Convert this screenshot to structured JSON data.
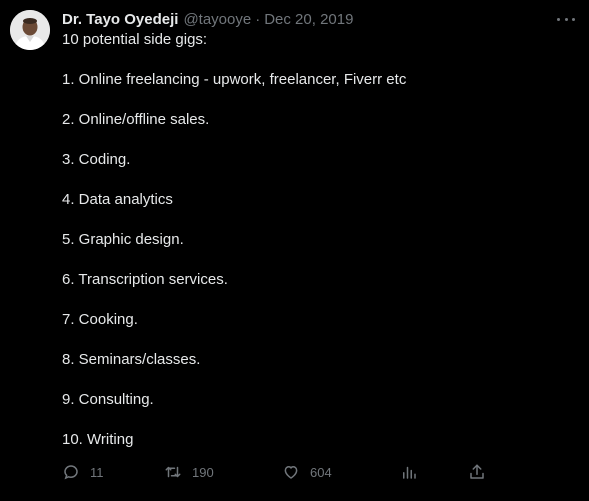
{
  "tweet": {
    "author_name": "Dr. Tayo Oyedeji",
    "handle": "@tayooye",
    "separator": "·",
    "date": "Dec 20, 2019",
    "intro": "10 potential side gigs:",
    "items": [
      "1. Online freelancing - upwork, freelancer, Fiverr etc",
      "2. Online/offline sales.",
      "3. Coding.",
      "4. Data analytics",
      "5. Graphic design.",
      "6. Transcription services.",
      "7. Cooking.",
      "8. Seminars/classes.",
      "9. Consulting.",
      "10. Writing"
    ]
  },
  "actions": {
    "replies": "11",
    "retweets": "190",
    "likes": "604"
  },
  "icons": {
    "reply": "reply-icon",
    "retweet": "retweet-icon",
    "like": "heart-icon",
    "views": "analytics-icon",
    "share": "share-icon",
    "more": "more-icon"
  },
  "colors": {
    "background": "#000000",
    "text": "#e7e9ea",
    "muted": "#71767b"
  }
}
